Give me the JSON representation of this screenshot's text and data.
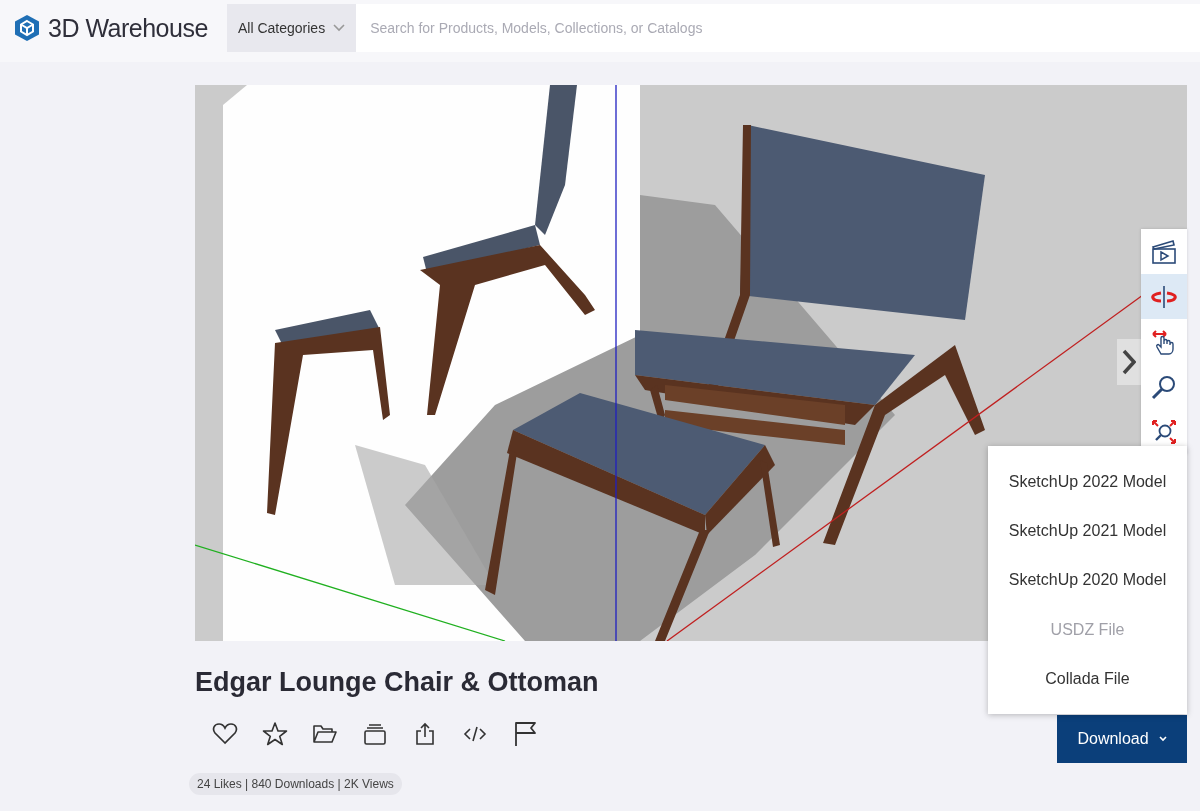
{
  "header": {
    "logo": "3D Warehouse",
    "category": "All Categories",
    "search": {
      "placeholder": "Search for Products, Models, Collections, or Catalogs"
    }
  },
  "viewer": {
    "tools": [
      {
        "kind": "scenes",
        "selected": false
      },
      {
        "kind": "orbit",
        "selected": true
      },
      {
        "kind": "pan",
        "selected": false
      },
      {
        "kind": "zoom",
        "selected": false
      },
      {
        "kind": "zoom-extents",
        "selected": false
      }
    ]
  },
  "model": {
    "title": "Edgar Lounge Chair & Ottoman",
    "actions": [
      {
        "kind": "like"
      },
      {
        "kind": "favorite"
      },
      {
        "kind": "collection"
      },
      {
        "kind": "catalog"
      },
      {
        "kind": "share"
      },
      {
        "kind": "embed"
      },
      {
        "kind": "report"
      }
    ],
    "stats": "24 Likes | 840 Downloads | 2K Views"
  },
  "download": {
    "label": "Download",
    "expanded": true,
    "options": [
      {
        "label": "SketchUp 2022 Model",
        "disabled": false
      },
      {
        "label": "SketchUp 2021 Model",
        "disabled": false
      },
      {
        "label": "SketchUp 2020 Model",
        "disabled": false
      },
      {
        "label": "USDZ File",
        "disabled": true
      },
      {
        "label": "Collada File",
        "disabled": false
      }
    ]
  }
}
